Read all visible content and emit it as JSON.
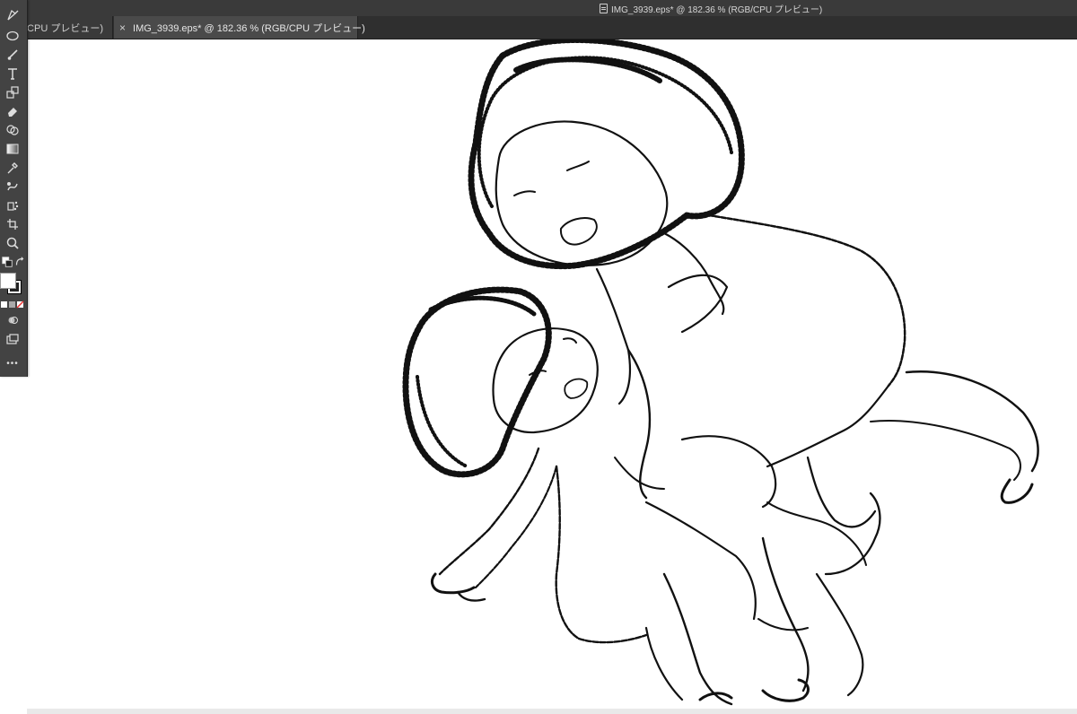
{
  "window": {
    "title": "IMG_3939.eps* @ 182.36 % (RGB/CPU プレビュー)"
  },
  "tabs": [
    {
      "label": "B/CPU プレビュー)",
      "active": false
    },
    {
      "label": "IMG_3939.eps* @ 182.36 % (RGB/CPU プレビュー)",
      "active": true,
      "close": "×"
    }
  ],
  "toolbar": {
    "tools": [
      "pen-icon",
      "ellipse-icon",
      "brush-icon",
      "type-icon",
      "scale-icon",
      "eraser-icon",
      "shape-builder-icon",
      "gradient-icon",
      "eyedropper-icon",
      "blend-icon",
      "symbol-sprayer-icon",
      "artboard-icon",
      "zoom-icon"
    ],
    "more_label": "•••"
  },
  "colors": {
    "chrome_dark": "#2f2f2f",
    "toolbar": "#434343",
    "active_tab": "#4a4a4a",
    "canvas": "#ffffff",
    "ink": "#111111"
  }
}
